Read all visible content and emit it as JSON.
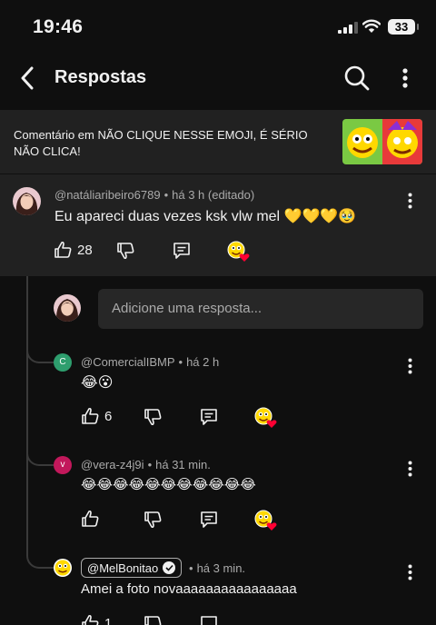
{
  "status_bar": {
    "time": "19:46",
    "battery": "33"
  },
  "header": {
    "title": "Respostas"
  },
  "context": {
    "text": "Comentário em NÃO CLIQUE NESSE EMOJI, É SÉRIO NÃO CLICA!"
  },
  "parent_comment": {
    "author": "@natáliaribeiro6789",
    "time": "há 3 h (editado)",
    "text": "Eu apareci duas vezes ksk vlw mel 💛💛💛🥹",
    "likes": "28"
  },
  "reply_input": {
    "placeholder": "Adicione uma resposta..."
  },
  "replies": [
    {
      "author": "@ComercialIBMP",
      "avatar_letter": "C",
      "avatar_color": "#2e9e6e",
      "time": "há 2 h",
      "text": "😂😮",
      "likes": "6"
    },
    {
      "author": "@vera-z4j9i",
      "avatar_letter": "v",
      "avatar_color": "#c2185b",
      "time": "há 31 min.",
      "text": "😂😂😂😂😂😂😂😂😂😂😂",
      "likes": ""
    },
    {
      "author": "@MelBonitao",
      "time": "há 3 min.",
      "text": "Amei a foto novaaaaaaaaaaaaaaaa",
      "likes": "1"
    }
  ],
  "colors": {
    "background": "#0f0f0f",
    "highlight": "#212121",
    "text": "#f1f1f1",
    "secondary_text": "#aaaaaa",
    "heart": "#ff0033"
  }
}
